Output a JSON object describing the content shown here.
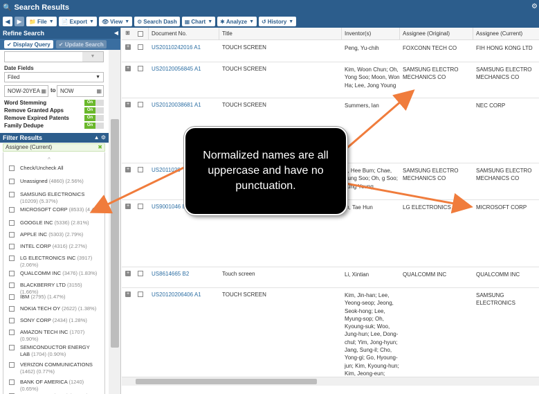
{
  "titlebar": {
    "icon": "search-icon",
    "title": "Search Results"
  },
  "toolbar": {
    "file": "File",
    "export": "Export",
    "view": "View",
    "search_dash": "Search Dash",
    "chart": "Chart",
    "analyze": "Analyze",
    "history": "History"
  },
  "refine": {
    "header": "Refine Search",
    "display_query": "Display Query",
    "update_search": "Update Search",
    "date_fields_label": "Date Fields",
    "date_field_value": "Filed",
    "date_from": "NOW-20YEA",
    "to_label": "to",
    "date_to": "NOW",
    "options": [
      {
        "label": "Word Stemming",
        "state": "On"
      },
      {
        "label": "Remove Granted Apps",
        "state": "On"
      },
      {
        "label": "Remove Expired Patents",
        "state": "On"
      },
      {
        "label": "Family Dedupe",
        "state": "On"
      }
    ]
  },
  "filter": {
    "header": "Filter Results",
    "tag": "Assignee (Current)",
    "check_all": "Check/Uncheck All",
    "items": [
      {
        "name": "Unassigned",
        "count": "(4860) (2.56%)"
      },
      {
        "name": "SAMSUNG ELECTRONICS",
        "count": "(10209) (5.37%)"
      },
      {
        "name": "MICROSOFT CORP",
        "count": "(8533) (4.4"
      },
      {
        "name": "GOOGLE INC",
        "count": "(5336) (2.81%)"
      },
      {
        "name": "APPLE INC",
        "count": "(5303) (2.79%)"
      },
      {
        "name": "INTEL CORP",
        "count": "(4316) (2.27%)"
      },
      {
        "name": "LG ELECTRONICS INC",
        "count": "(3917) (2.06%)"
      },
      {
        "name": "QUALCOMM INC",
        "count": "(3476) (1.83%)"
      },
      {
        "name": "BLACKBERRY LTD",
        "count": "(3155) (1.66%)"
      },
      {
        "name": "IBM",
        "count": "(2795) (1.47%)"
      },
      {
        "name": "NOKIA TECH OY",
        "count": "(2622) (1.38%)"
      },
      {
        "name": "SONY CORP",
        "count": "(2434) (1.28%)"
      },
      {
        "name": "AMAZON TECH INC",
        "count": "(1707) (0.90%)"
      },
      {
        "name": "SEMICONDUCTOR ENERGY LAB",
        "count": "(1704) (0.90%)"
      },
      {
        "name": "VERIZON COMMUNICATIONS",
        "count": "(1462) (0.77%)"
      },
      {
        "name": "BANK OF AMERICA",
        "count": "(1240) (0.65%)"
      },
      {
        "name": "NOKIA CORP",
        "count": "(1194) (0.63%)"
      }
    ]
  },
  "grid": {
    "columns": [
      "Document No.",
      "Title",
      "Inventor(s)",
      "Assignee (Original)",
      "Assignee (Current)"
    ],
    "rows": [
      {
        "doc": "US20110242016 A1",
        "title": "TOUCH SCREEN",
        "inventors": "Peng, Yu-chih",
        "assignee_original": "FOXCONN TECH CO",
        "assignee_current": "FIH HONG KONG LTD"
      },
      {
        "doc": "US20120056845 A1",
        "title": "TOUCH SCREEN",
        "inventors": "Kim, Woon Chun; Oh, Yong Soo; Moon, Won Ha; Lee, Jong Young",
        "assignee_original": "SAMSUNG ELECTRO MECHANICS CO",
        "assignee_current": "SAMSUNG ELECTRO MECHANICS CO"
      },
      {
        "doc": "US20120038681 A1",
        "title": "TOUCH SCREEN",
        "inventors": "Summers, Ian",
        "assignee_original": "",
        "assignee_current": "NEC CORP"
      },
      {
        "doc": "US2011028",
        "title": "",
        "inventors": "e, Hee Bum; Chae, hung Soo; Oh, g Soo; Jung Young",
        "assignee_original": "SAMSUNG ELECTRO MECHANICS CO",
        "assignee_current": "SAMSUNG ELECTRO MECHANICS CO"
      },
      {
        "doc": "US9001046 B",
        "title": "",
        "inventors": "m, Tae Hun",
        "assignee_original": "LG ELECTRONICS INC",
        "assignee_current": "MICROSOFT CORP"
      },
      {
        "doc": "US8614665 B2",
        "title": "Touch screen",
        "inventors": "Li, Xintian",
        "assignee_original": "QUALCOMM INC",
        "assignee_current": "QUALCOMM INC"
      },
      {
        "doc": "US20120206406 A1",
        "title": "TOUCH SCREEN",
        "inventors": "Kim, Jin-han; Lee, Yeong-seop; Jeong, Seok-hong; Lee, Myung-sop; Oh, Kyoung-suk; Woo, Jung-hun; Lee, Dong-chul; Yim, Jong-hyun; Jang, Sung-il; Cho, Yong-gi; Go, Hyoung-jun; Kim, Kyoung-hun; Kim, Jeong-eun;",
        "assignee_original": "",
        "assignee_current": "SAMSUNG ELECTRONICS"
      }
    ]
  },
  "callout": {
    "text": "Normalized names are all uppercase and have no punctuation."
  },
  "colors": {
    "header_blue": "#2c5d8c",
    "link_blue": "#2c6ea3",
    "toggle_green": "#6ab82b",
    "arrow_orange": "#f07c3c"
  }
}
